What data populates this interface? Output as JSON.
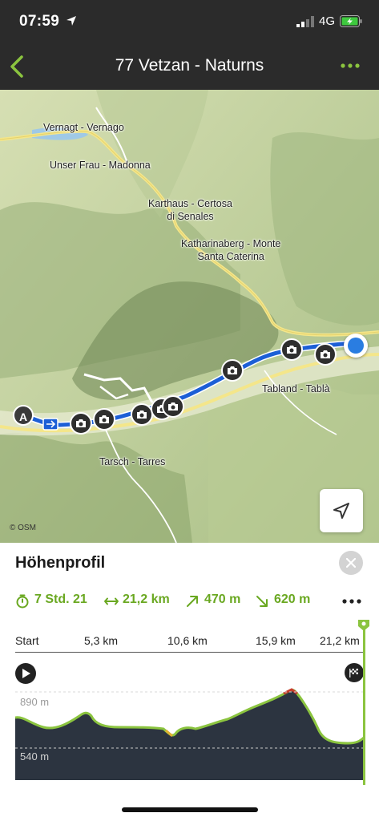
{
  "status": {
    "time": "07:59",
    "network": "4G"
  },
  "nav": {
    "title": "77 Vetzan - Naturns",
    "back_icon": "chevron-left-icon",
    "menu_icon": "more-icon"
  },
  "colors": {
    "accent": "#8bc43f",
    "route": "#1c5fd6",
    "topbar": "#2b2b2b",
    "elevation_fill": "#2c3440"
  },
  "map": {
    "places": [
      {
        "name": "Vernagt - Vernago"
      },
      {
        "name": "Unser Frau - Madonna"
      },
      {
        "name": "Karthaus - Certosa di Senales",
        "line1": "Karthaus - Certosa",
        "line2": "di Senales"
      },
      {
        "name": "Katharinaberg - Monte Santa Caterina",
        "line1": "Katharinaberg - Monte",
        "line2": "Santa Caterina"
      },
      {
        "name": "Tabland - Tablà"
      },
      {
        "name": "Tarsch - Tarres"
      }
    ],
    "start_marker": "A",
    "attribution": "© OSM"
  },
  "panel": {
    "title": "Höhenprofil",
    "stats": {
      "duration": "7 Std. 21",
      "distance": "21,2 km",
      "ascent": "470 m",
      "descent": "620 m"
    },
    "axis_ticks": [
      "Start",
      "5,3 km",
      "10,6 km",
      "15,9 km",
      "21,2 km"
    ],
    "elevation_labels": [
      "890 m",
      "540 m"
    ]
  }
}
